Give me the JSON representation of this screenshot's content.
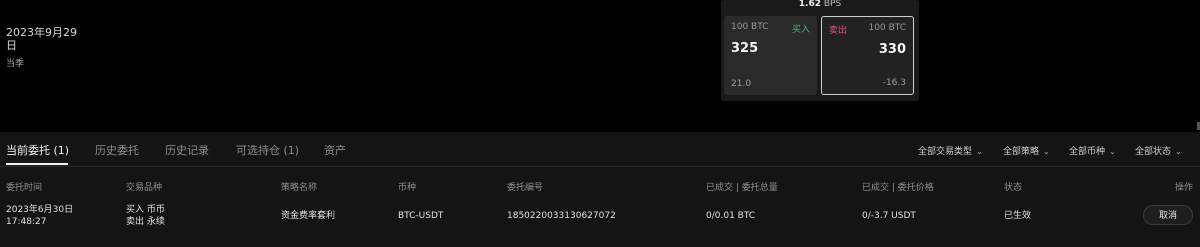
{
  "expiry": {
    "date": "2023年9月29日",
    "type": "当季"
  },
  "orderbook": {
    "bps_value": "1.62",
    "bps_unit": "BPS",
    "buy": {
      "qty": "100 BTC",
      "tag": "买入",
      "price": "325",
      "bottom": "21.0"
    },
    "sell": {
      "tag": "卖出",
      "qty": "100 BTC",
      "price": "330",
      "bottom": "-16.3"
    }
  },
  "tabs": [
    {
      "label": "当前委托 (1)",
      "active": true
    },
    {
      "label": "历史委托"
    },
    {
      "label": "历史记录"
    },
    {
      "label": "可选持仓 (1)"
    },
    {
      "label": "资产"
    }
  ],
  "filters": [
    "全部交易类型",
    "全部策略",
    "全部币种",
    "全部状态"
  ],
  "columns": [
    "委托时间",
    "交易品种",
    "策略名称",
    "币种",
    "委托编号",
    "已成交 | 委托总量",
    "已成交 | 委托价格",
    "状态",
    "操作"
  ],
  "rows": [
    {
      "time_date": "2023年6月30日",
      "time_clock": "17:48:27",
      "instrument_1": "买入 币币",
      "instrument_2": "卖出 永续",
      "strategy": "资金费率套利",
      "currency": "BTC-USDT",
      "order_id": "1850220033130627072",
      "filled_qty": "0/0.01 BTC",
      "filled_price": "0/-3.7 USDT",
      "status": "已生效",
      "action": "取消"
    }
  ]
}
